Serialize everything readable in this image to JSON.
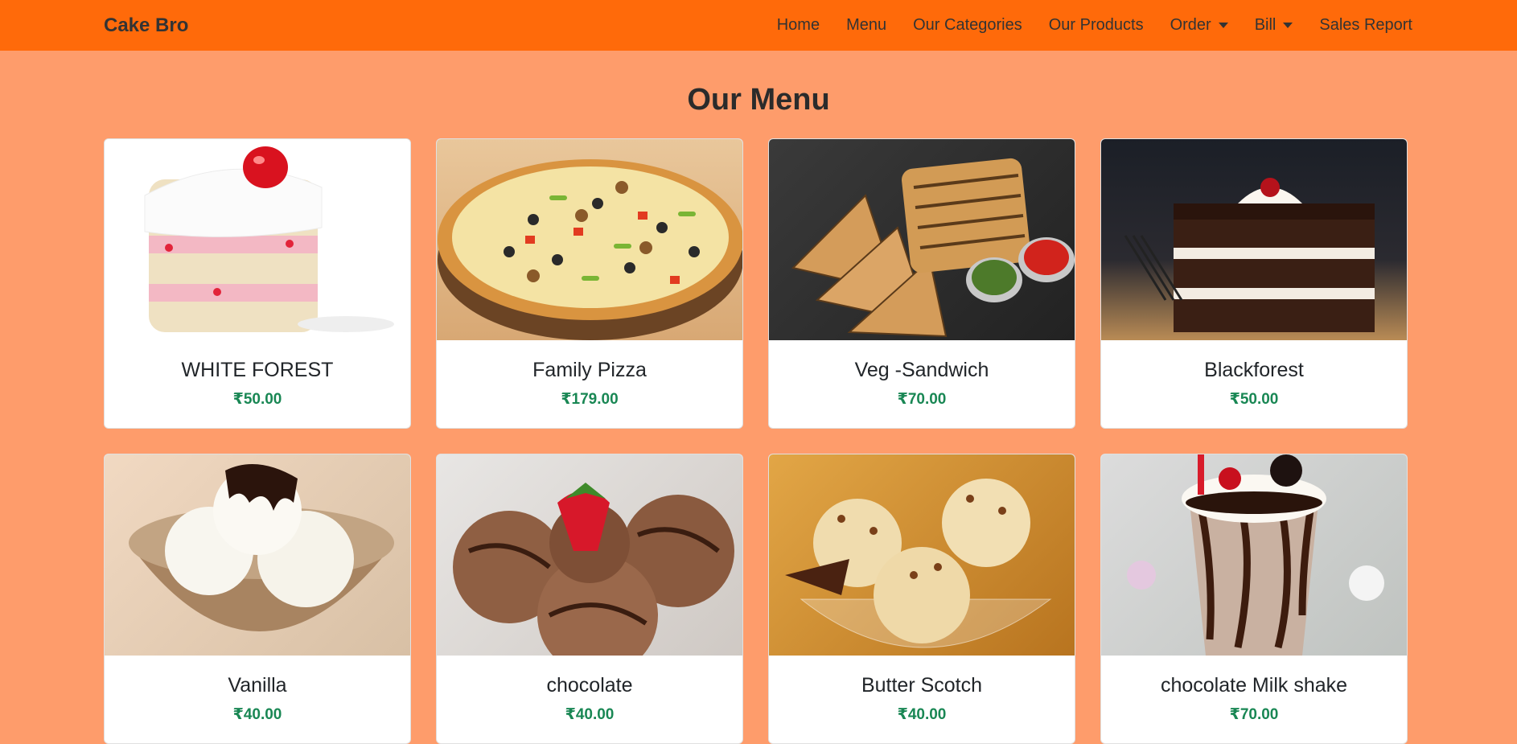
{
  "navbar": {
    "brand": "Cake Bro",
    "items": [
      {
        "label": "Home",
        "dropdown": false
      },
      {
        "label": "Menu",
        "dropdown": false
      },
      {
        "label": "Our Categories",
        "dropdown": false
      },
      {
        "label": "Our Products",
        "dropdown": false
      },
      {
        "label": "Order",
        "dropdown": true
      },
      {
        "label": "Bill",
        "dropdown": true
      },
      {
        "label": "Sales Report",
        "dropdown": false
      }
    ]
  },
  "page": {
    "title": "Our Menu"
  },
  "products": [
    {
      "name": "WHITE FOREST",
      "price": "₹50.00",
      "image": "white-forest-cake-image"
    },
    {
      "name": "Family Pizza",
      "price": "₹179.00",
      "image": "pizza-image"
    },
    {
      "name": "Veg -Sandwich",
      "price": "₹70.00",
      "image": "sandwich-image"
    },
    {
      "name": "Blackforest",
      "price": "₹50.00",
      "image": "blackforest-cake-image"
    },
    {
      "name": "Vanilla",
      "price": "₹40.00",
      "image": "vanilla-icecream-image"
    },
    {
      "name": "chocolate",
      "price": "₹40.00",
      "image": "chocolate-icecream-image"
    },
    {
      "name": "Butter Scotch",
      "price": "₹40.00",
      "image": "butterscotch-icecream-image"
    },
    {
      "name": "chocolate Milk shake",
      "price": "₹70.00",
      "image": "milkshake-image"
    }
  ],
  "colors": {
    "navbar": "#ff6a0a",
    "background": "#fe9c6b",
    "price": "#198754"
  }
}
